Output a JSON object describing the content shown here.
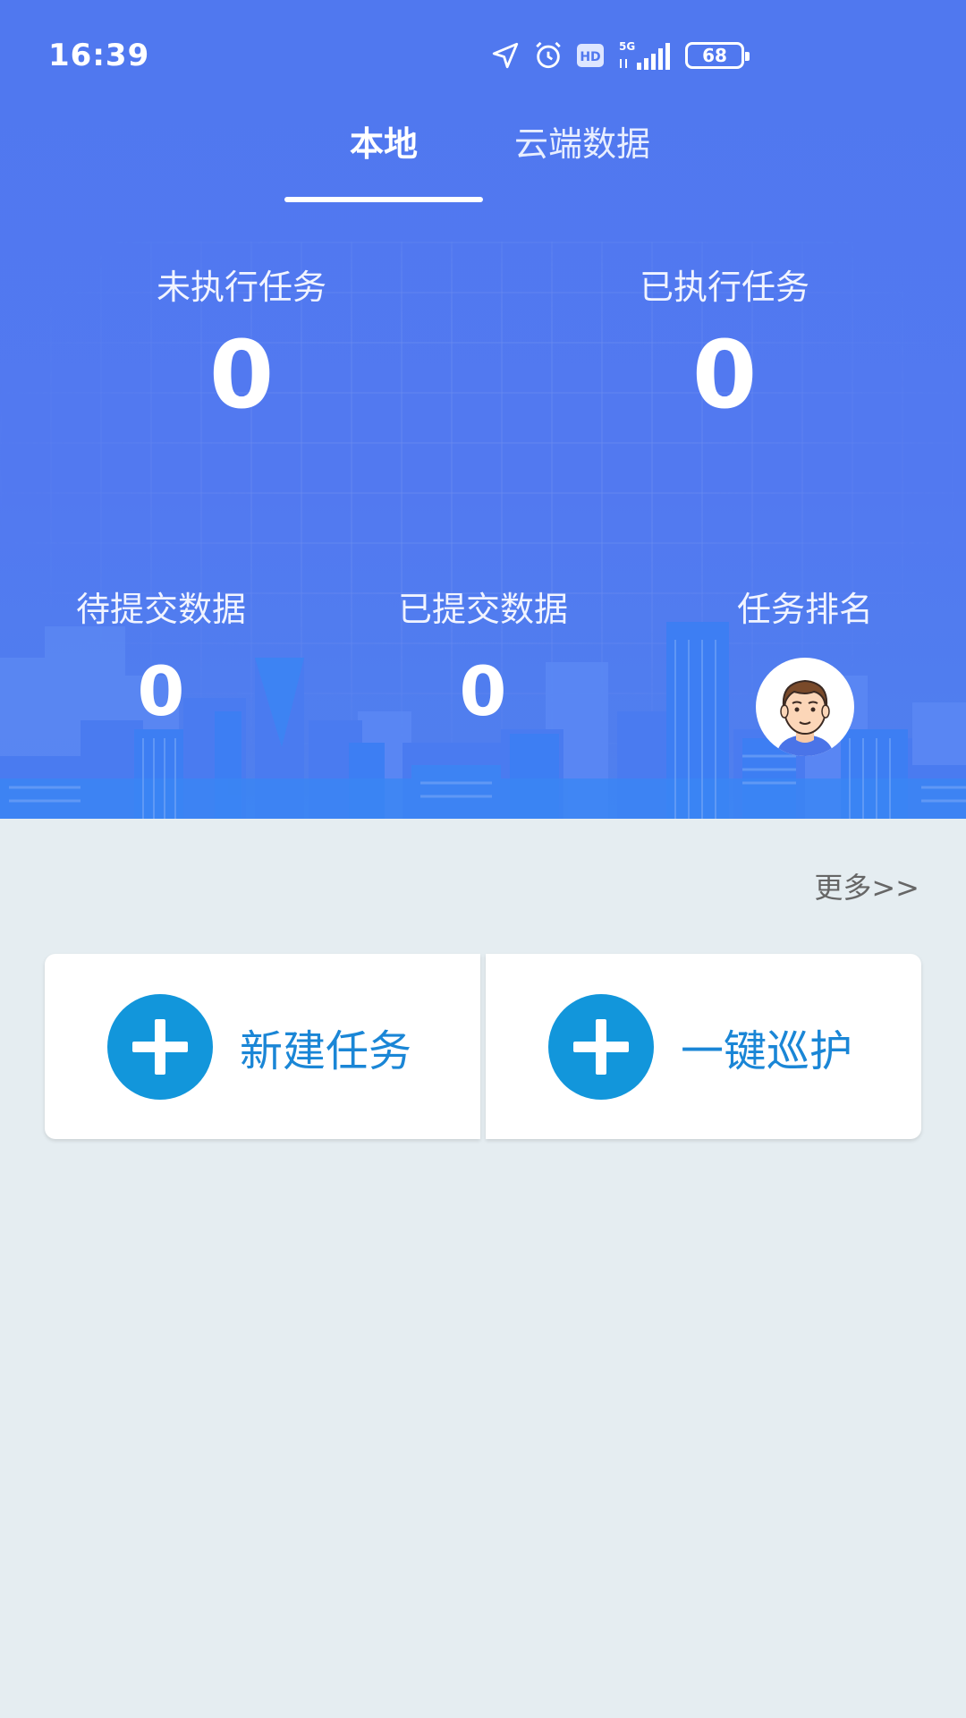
{
  "status_bar": {
    "time": "16:39",
    "network": "5G",
    "hd": "HD",
    "battery": "68",
    "icons": [
      "location-arrow-icon",
      "alarm-icon",
      "hd-icon",
      "signal-5g-icon",
      "battery-icon"
    ]
  },
  "tabs": [
    {
      "label": "本地",
      "selected": true
    },
    {
      "label": "云端数据",
      "selected": false
    }
  ],
  "stats": {
    "unexecuted": {
      "label": "未执行任务",
      "value": "0"
    },
    "executed": {
      "label": "已执行任务",
      "value": "0"
    },
    "pending": {
      "label": "待提交数据",
      "value": "0"
    },
    "submitted": {
      "label": "已提交数据",
      "value": "0"
    },
    "ranking": {
      "label": "任务排名",
      "avatar_icon": "user-avatar-icon"
    }
  },
  "more_link": "更多>>",
  "actions": [
    {
      "label": "新建任务",
      "icon": "plus-circle-icon"
    },
    {
      "label": "一键巡护",
      "icon": "plus-circle-icon"
    }
  ],
  "colors": {
    "header_blue": "#5078ef",
    "accent_blue": "#1296db",
    "action_text": "#1a86d6",
    "page_background": "#e5edf1"
  }
}
